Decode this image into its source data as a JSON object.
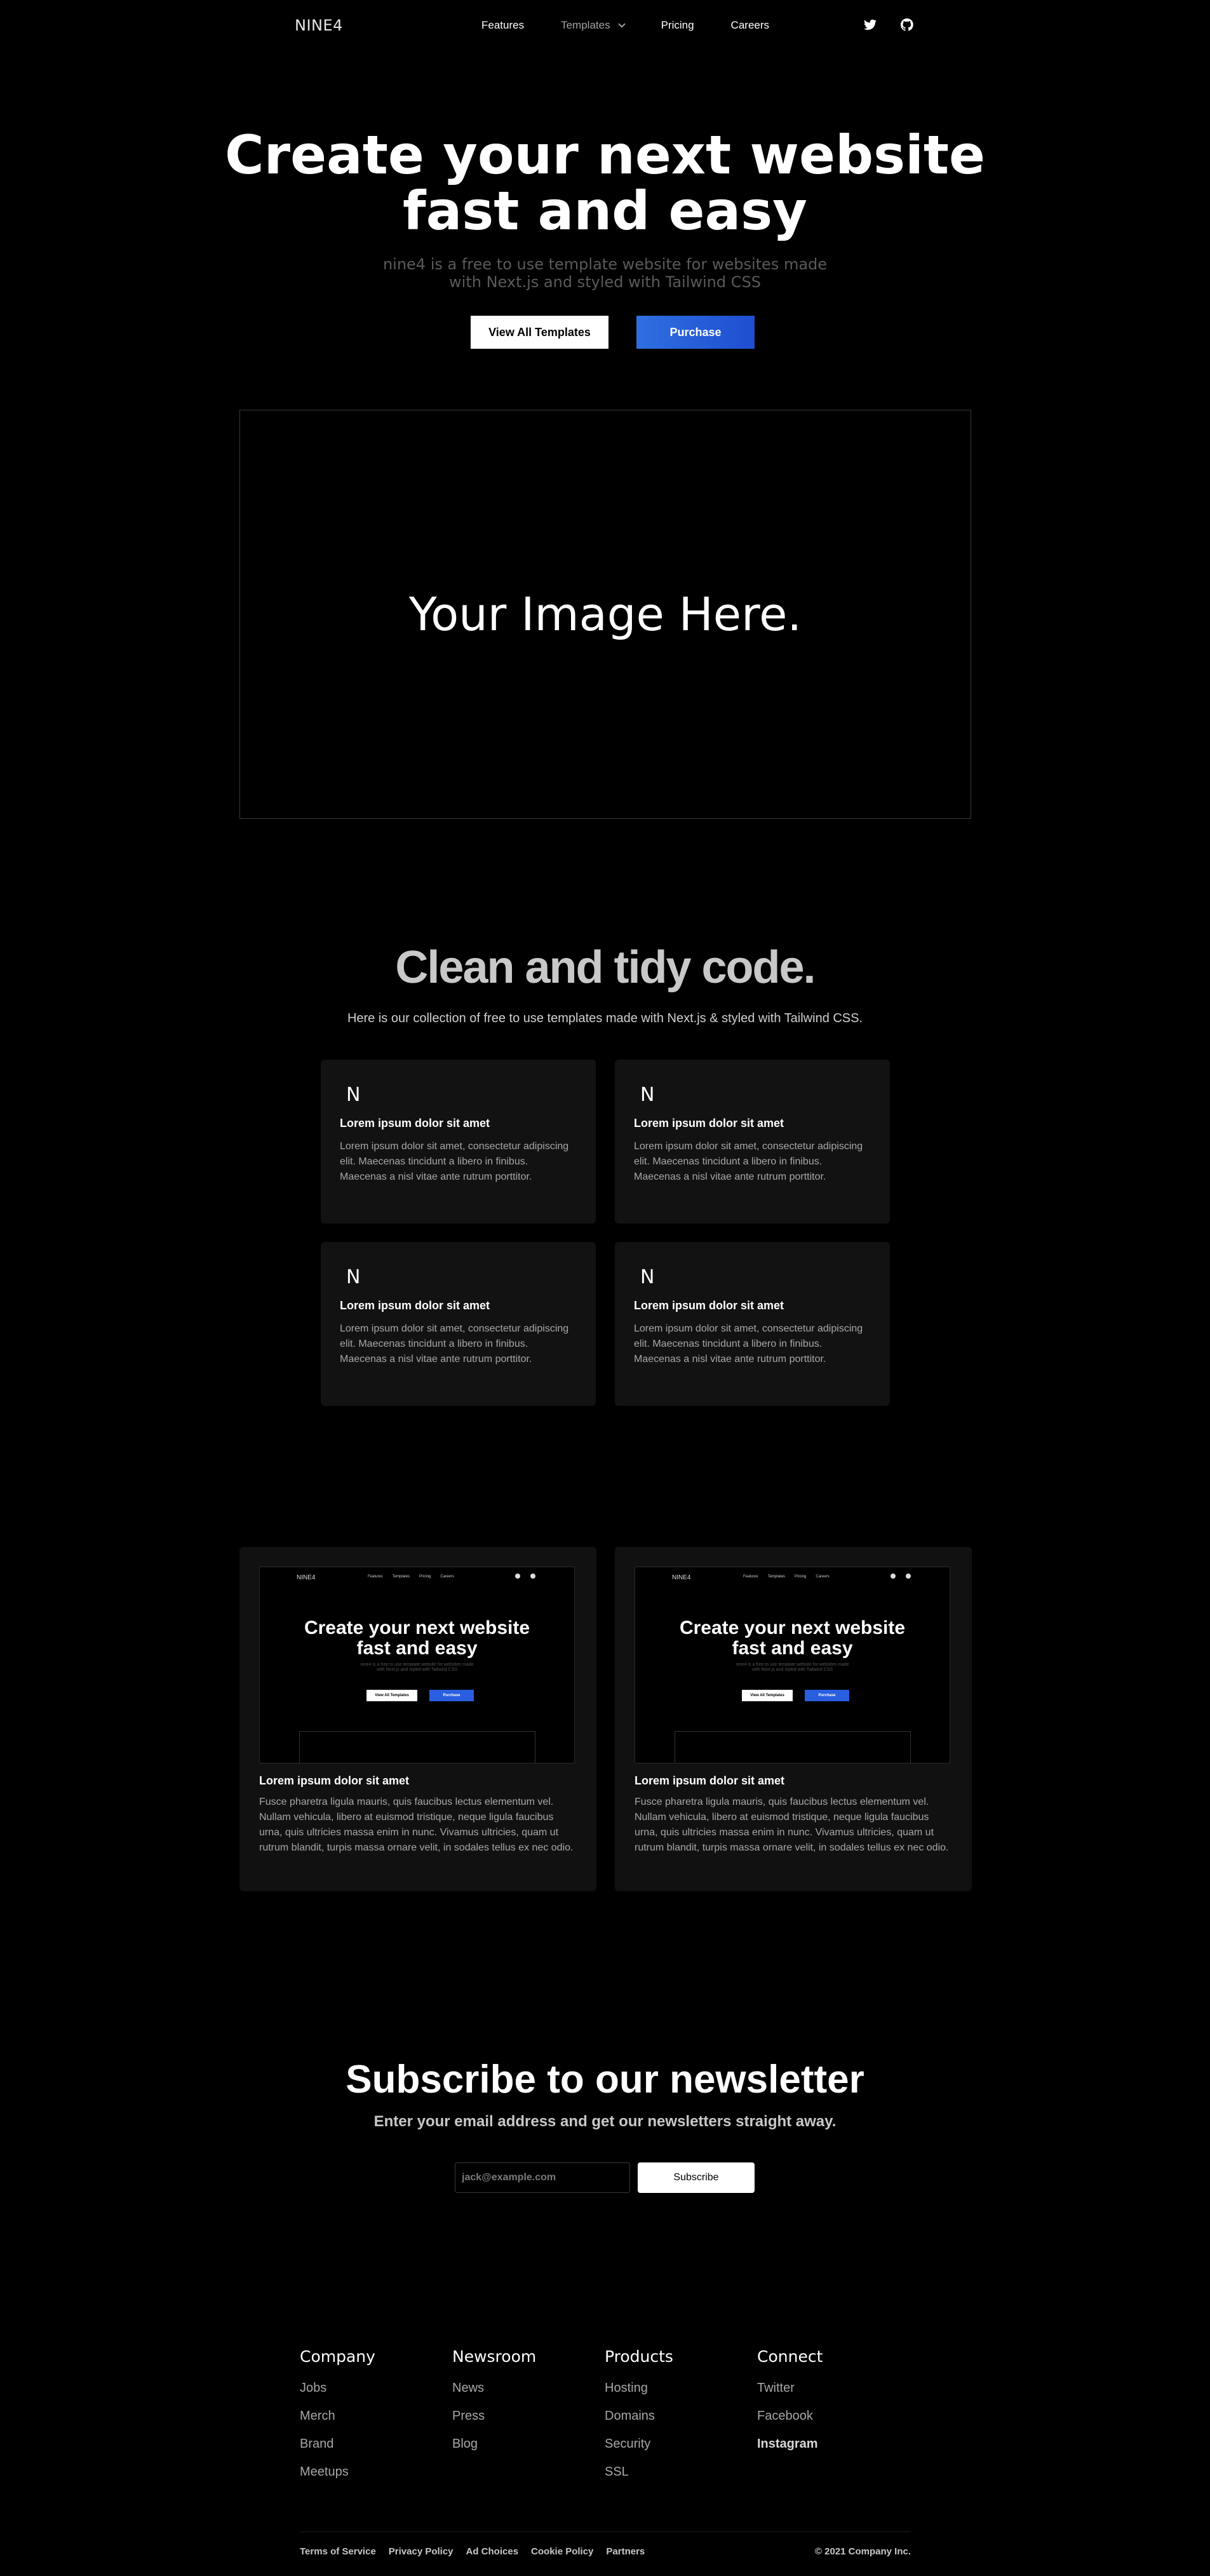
{
  "nav": {
    "logo": "NINE4",
    "links": [
      "Features",
      "Templates",
      "Pricing",
      "Careers"
    ],
    "icons": [
      "twitter-icon",
      "github-icon"
    ]
  },
  "hero": {
    "title_line1": "Create your next website",
    "title_line2": "fast and easy",
    "subtitle_line1": "nine4 is a free to use template website for websites made",
    "subtitle_line2": "with Next.js and styled with Tailwind CSS",
    "primary_button": "View All Templates",
    "secondary_button": "Purchase",
    "image_placeholder": "Your Image Here."
  },
  "features": {
    "title": "Clean and tidy code.",
    "subtitle": "Here is our collection of free to use templates made with Next.js & styled with Tailwind CSS.",
    "cards": [
      {
        "icon": "N",
        "heading": "Lorem ipsum dolor sit amet",
        "text": "Lorem ipsum dolor sit amet, consectetur adipiscing elit. Maecenas tincidunt a libero in finibus. Maecenas a nisl vitae ante rutrum porttitor."
      },
      {
        "icon": "N",
        "heading": "Lorem ipsum dolor sit amet",
        "text": "Lorem ipsum dolor sit amet, consectetur adipiscing elit. Maecenas tincidunt a libero in finibus. Maecenas a nisl vitae ante rutrum porttitor."
      },
      {
        "icon": "N",
        "heading": "Lorem ipsum dolor sit amet",
        "text": "Lorem ipsum dolor sit amet, consectetur adipiscing elit. Maecenas tincidunt a libero in finibus. Maecenas a nisl vitae ante rutrum porttitor."
      },
      {
        "icon": "N",
        "heading": "Lorem ipsum dolor sit amet",
        "text": "Lorem ipsum dolor sit amet, consectetur adipiscing elit. Maecenas tincidunt a libero in finibus. Maecenas a nisl vitae ante rutrum porttitor."
      }
    ]
  },
  "templates": {
    "preview": {
      "logo": "NINE4",
      "links": [
        "Features",
        "Templates",
        "Pricing",
        "Careers"
      ],
      "title_line1": "Create your next website",
      "title_line2": "fast and easy",
      "subtitle_line1": "nine4 is a free to use template website for websites made",
      "subtitle_line2": "with Next.js and styled with Tailwind CSS",
      "primary_button": "View All Templates",
      "secondary_button": "Purchase"
    },
    "cards": [
      {
        "heading": "Lorem ipsum dolor sit amet",
        "text": "Fusce pharetra ligula mauris, quis faucibus lectus elementum vel. Nullam vehicula, libero at euismod tristique, neque ligula faucibus urna, quis ultricies massa enim in nunc. Vivamus ultricies, quam ut rutrum blandit, turpis massa ornare velit, in sodales tellus ex nec odio."
      },
      {
        "heading": "Lorem ipsum dolor sit amet",
        "text": "Fusce pharetra ligula mauris, quis faucibus lectus elementum vel. Nullam vehicula, libero at euismod tristique, neque ligula faucibus urna, quis ultricies massa enim in nunc. Vivamus ultricies, quam ut rutrum blandit, turpis massa ornare velit, in sodales tellus ex nec odio."
      }
    ]
  },
  "newsletter": {
    "title": "Subscribe to our newsletter",
    "subtitle": "Enter your email address and get our newsletters straight away.",
    "placeholder": "jack@example.com",
    "button": "Subscribe"
  },
  "footer": {
    "columns": [
      {
        "heading": "Company",
        "links": [
          "Jobs",
          "Merch",
          "Brand",
          "Meetups"
        ]
      },
      {
        "heading": "Newsroom",
        "links": [
          "News",
          "Press",
          "Blog"
        ]
      },
      {
        "heading": "Products",
        "links": [
          "Hosting",
          "Domains",
          "Security",
          "SSL"
        ]
      },
      {
        "heading": "Connect",
        "links": [
          "Twitter",
          "Facebook",
          "Instagram"
        ]
      }
    ],
    "legal": [
      "Terms of Service",
      "Privacy Policy",
      "Ad Choices",
      "Cookie Policy",
      "Partners"
    ],
    "copyright": "© 2021 Company Inc."
  }
}
